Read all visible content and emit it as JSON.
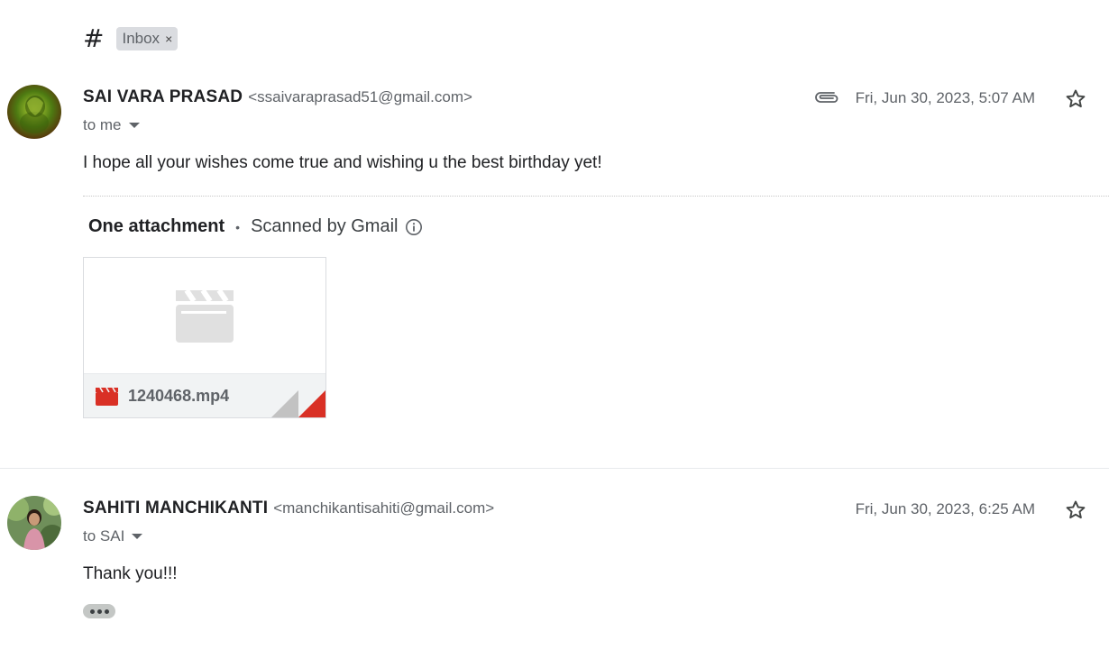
{
  "thread": {
    "label": "Inbox",
    "label_remove": "×"
  },
  "messages": [
    {
      "sender_name": "SAI VARA PRASAD",
      "sender_email": "<ssaivaraprasad51@gmail.com>",
      "recipient": "to me",
      "date": "Fri, Jun 30, 2023, 5:07 AM",
      "has_attachment": true,
      "body": "I hope all your wishes come true and wishing u the best birthday yet!"
    },
    {
      "sender_name": "SAHITI MANCHIKANTI",
      "sender_email": "<manchikantisahiti@gmail.com>",
      "recipient": "to SAI",
      "date": "Fri, Jun 30, 2023, 6:25 AM",
      "has_attachment": false,
      "body": "Thank you!!!"
    }
  ],
  "attachments": {
    "count_label": "One attachment",
    "separator": "•",
    "scan_label": "Scanned by Gmail",
    "items": [
      {
        "file_name": "1240468.mp4",
        "file_type": "video",
        "accent_color": "#d93025"
      }
    ]
  },
  "icons": {
    "subject": "hash-icon",
    "attachment": "paperclip-icon",
    "star": "star-icon",
    "info": "info-icon",
    "more": "ellipsis-icon"
  }
}
